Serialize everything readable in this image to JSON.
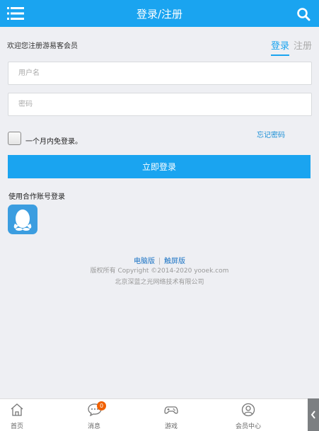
{
  "header": {
    "title": "登录/注册",
    "menu_icon": "hamburger-menu-icon",
    "search_icon": "search-icon",
    "bg_color": "#1aa4f0"
  },
  "welcome_text": "欢迎您注册游易客会员",
  "tabs": [
    {
      "label": "登录",
      "active": true
    },
    {
      "label": "注册",
      "active": false
    }
  ],
  "form": {
    "username_placeholder": "用户名",
    "password_placeholder": "密码",
    "remember_label": "一个月内免登录。",
    "forgot_label": "忘记密码",
    "submit_label": "立即登录"
  },
  "third_party": {
    "label": "使用合作账号登录",
    "icon": "qq-penguin-icon"
  },
  "footer": {
    "link_pc": "电脑版",
    "link_touch": "触屏版",
    "copyright": "版权所有 Copyright ©2014-2020 yooek.com",
    "company": "北京深蓝之光网络技术有限公司"
  },
  "bottom_nav": [
    {
      "label": "首页",
      "icon": "home-icon"
    },
    {
      "label": "消息",
      "icon": "message-icon",
      "badge": "0"
    },
    {
      "label": "游戏",
      "icon": "gamepad-icon"
    },
    {
      "label": "会员中心",
      "icon": "user-icon"
    }
  ],
  "side_toggle_icon": "chevron-left-icon"
}
